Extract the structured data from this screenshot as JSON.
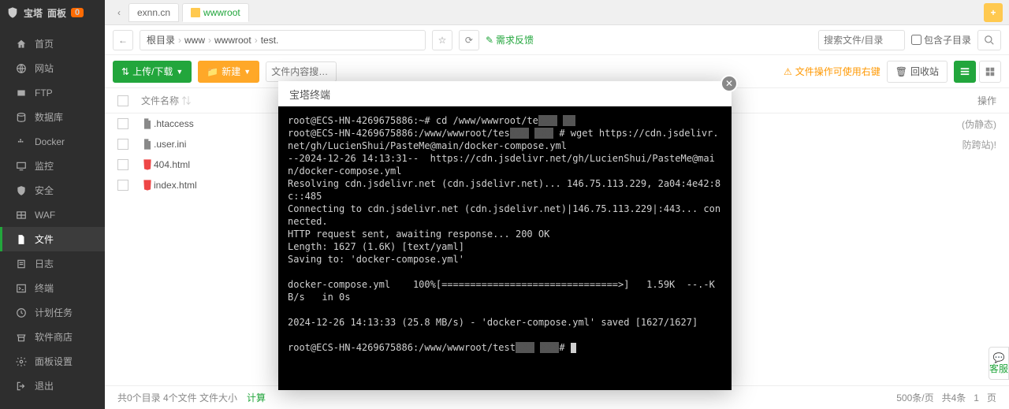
{
  "sidebar": {
    "brand": "宝塔",
    "brand2": "面板",
    "badge": "0",
    "items": [
      {
        "icon": "home",
        "label": "首页"
      },
      {
        "icon": "globe",
        "label": "网站"
      },
      {
        "icon": "ftp",
        "label": "FTP"
      },
      {
        "icon": "db",
        "label": "数据库"
      },
      {
        "icon": "docker",
        "label": "Docker"
      },
      {
        "icon": "monitor",
        "label": "监控"
      },
      {
        "icon": "shield",
        "label": "安全"
      },
      {
        "icon": "waf",
        "label": "WAF"
      },
      {
        "icon": "file",
        "label": "文件"
      },
      {
        "icon": "log",
        "label": "日志"
      },
      {
        "icon": "terminal",
        "label": "终端"
      },
      {
        "icon": "task",
        "label": "计划任务"
      },
      {
        "icon": "store",
        "label": "软件商店"
      },
      {
        "icon": "panel",
        "label": "面板设置"
      },
      {
        "icon": "exit",
        "label": "退出"
      }
    ],
    "activeIndex": 8
  },
  "tabs": {
    "arrow": "‹",
    "items": [
      {
        "label": "exnn.cn"
      },
      {
        "label": "wwwroot",
        "folder": true,
        "active": true
      }
    ],
    "add": "+"
  },
  "pathbar": {
    "back": "←",
    "crumbs": [
      "根目录",
      "www",
      "wwwroot",
      "test."
    ],
    "star": "☆",
    "refresh": "⟳",
    "feedback": "需求反馈",
    "searchPlaceholder": "搜索文件/目录",
    "subdir": "包含子目录"
  },
  "toolbar": {
    "upload": "上传/下载",
    "new": "新建",
    "filterPlaceholder": "文件内容搜…",
    "warn": "文件操作可使用右键",
    "recycle": "回收站"
  },
  "thead": {
    "name": "文件名称",
    "action": "操作"
  },
  "files": [
    {
      "icon": "txt",
      "name": ".htaccess",
      "rest": "(伪静态)"
    },
    {
      "icon": "txt",
      "name": ".user.ini",
      "rest": "防跨站)!"
    },
    {
      "icon": "html",
      "name": "404.html",
      "rest": ""
    },
    {
      "icon": "html",
      "name": "index.html",
      "rest": ""
    }
  ],
  "footer": {
    "sel": "共0个目录  4个文件  文件大小",
    "calc": "计算",
    "perpage": "500条/页",
    "total": "共4条",
    "page": "1",
    "unit": "页"
  },
  "kefu": "客服",
  "modal": {
    "title": "宝塔终端",
    "lines": [
      "root@ECS-HN-4269675886:~# cd /www/wwwroot/te▮▮▮ ▮▮",
      "root@ECS-HN-4269675886:/www/wwwroot/tes▮▮▮ ▮▮▮ # wget https://cdn.jsdelivr.net/gh/LucienShui/PasteMe@main/docker-compose.yml",
      "--2024-12-26 14:13:31--  https://cdn.jsdelivr.net/gh/LucienShui/PasteMe@main/docker-compose.yml",
      "Resolving cdn.jsdelivr.net (cdn.jsdelivr.net)... 146.75.113.229, 2a04:4e42:8c::485",
      "Connecting to cdn.jsdelivr.net (cdn.jsdelivr.net)|146.75.113.229|:443... connected.",
      "HTTP request sent, awaiting response... 200 OK",
      "Length: 1627 (1.6K) [text/yaml]",
      "Saving to: 'docker-compose.yml'",
      "",
      "docker-compose.yml    100%[===============================>]   1.59K  --.-KB/s   in 0s",
      "",
      "2024-12-26 14:13:33 (25.8 MB/s) - 'docker-compose.yml' saved [1627/1627]",
      "",
      "root@ECS-HN-4269675886:/www/wwwroot/test▮▮▮ ▮▮▮# "
    ]
  }
}
